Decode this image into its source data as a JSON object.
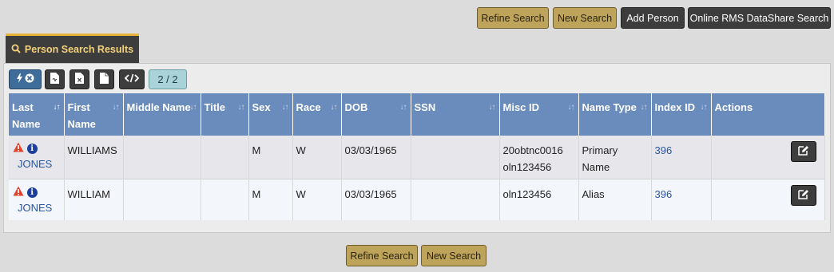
{
  "top_buttons": {
    "refine": "Refine Search",
    "new_search": "New Search",
    "add_person": "Add Person",
    "online_rms": "Online RMS DataShare Search"
  },
  "tab": {
    "label": "Person Search Results",
    "icon": "search-icon"
  },
  "toolbar": {
    "icons": [
      "bolt-clear-icon",
      "pdf-icon",
      "excel-icon",
      "file-icon",
      "code-icon"
    ],
    "page_indicator": "2 / 2"
  },
  "table": {
    "columns": [
      {
        "label": "Last Name"
      },
      {
        "label": "First Name"
      },
      {
        "label": "Middle Name"
      },
      {
        "label": "Title"
      },
      {
        "label": "Sex"
      },
      {
        "label": "Race"
      },
      {
        "label": "DOB"
      },
      {
        "label": "SSN"
      },
      {
        "label": "Misc ID"
      },
      {
        "label": "Name Type"
      },
      {
        "label": "Index ID"
      },
      {
        "label": "Actions"
      }
    ],
    "rows": [
      {
        "last_name": "JONES",
        "first_name": "WILLIAMS",
        "middle_name": "",
        "title": "",
        "sex": "M",
        "race": "W",
        "dob": "03/03/1965",
        "ssn": "",
        "misc_id_1": "20obtnc0016",
        "misc_id_2": "oln123456",
        "name_type": "Primary Name",
        "index_id": "396"
      },
      {
        "last_name": "JONES",
        "first_name": "WILLIAM",
        "middle_name": "",
        "title": "",
        "sex": "M",
        "race": "W",
        "dob": "03/03/1965",
        "ssn": "",
        "misc_id_1": "oln123456",
        "misc_id_2": "",
        "name_type": "Alias",
        "index_id": "396"
      }
    ]
  },
  "bottom_buttons": {
    "refine": "Refine Search",
    "new_search": "New Search"
  },
  "colors": {
    "gold_button": "#bea35a",
    "dark_button": "#3d3d3d",
    "header_blue": "#6a8cbd",
    "tab_accent": "#e8b33b",
    "link": "#2b55a1"
  }
}
